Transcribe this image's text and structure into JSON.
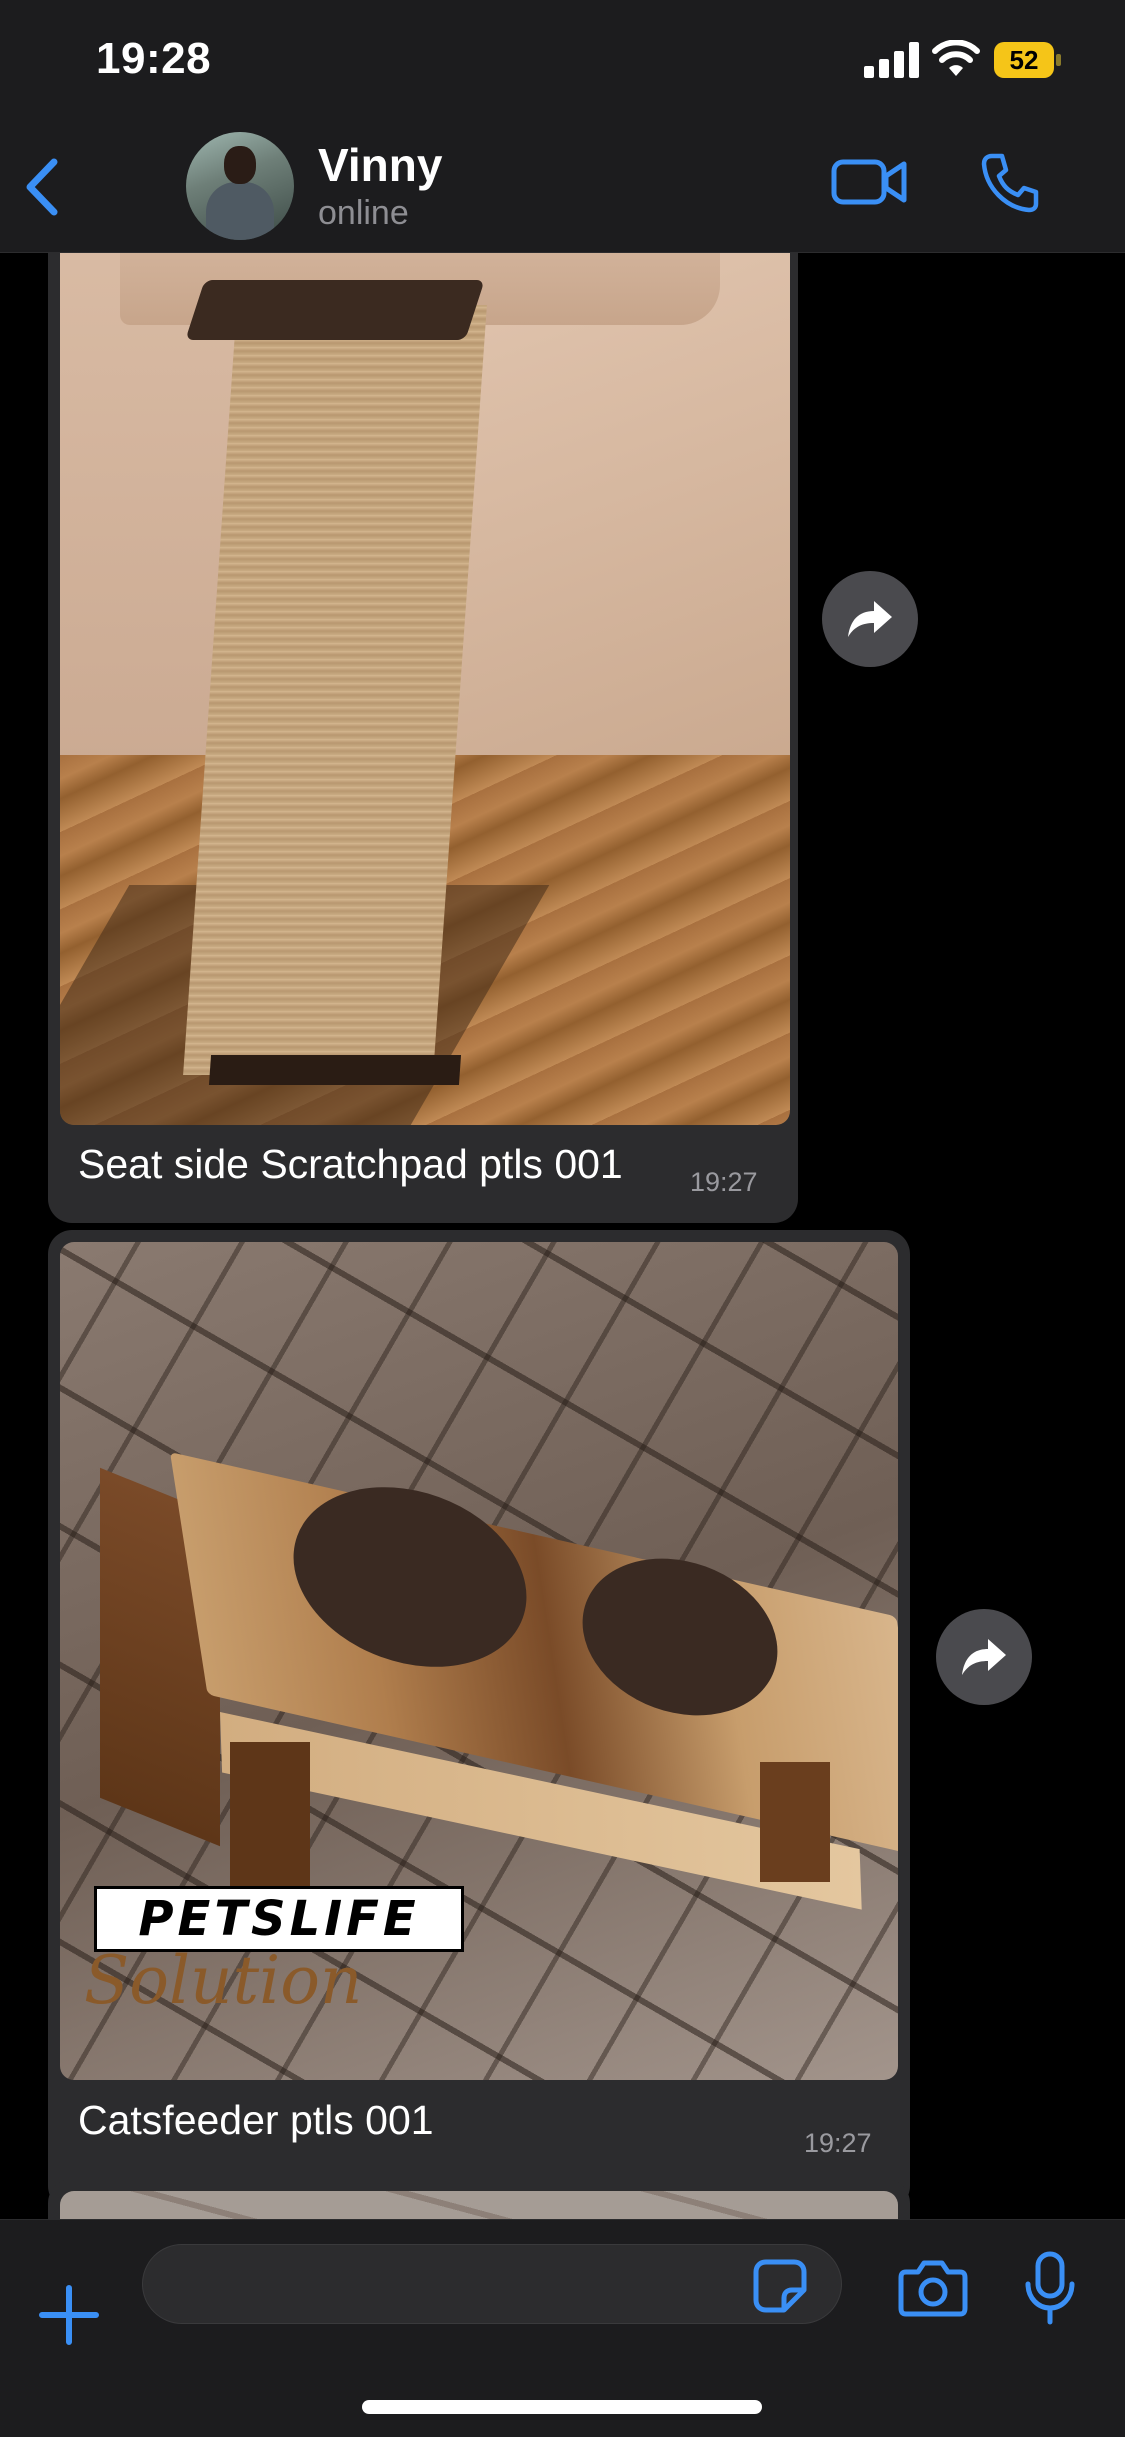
{
  "status_bar": {
    "time": "19:28",
    "battery": "52",
    "battery_color": "#f5c518"
  },
  "header": {
    "back_icon": "chevron-left-icon",
    "contact_name": "Vinny",
    "contact_status": "online",
    "video_icon": "video-camera-icon",
    "call_icon": "phone-icon",
    "accent_color": "#3a8ff5"
  },
  "messages": [
    {
      "type": "image",
      "image_description": "Sofa with jute seat side scratch pad",
      "caption": "Seat side Scratchpad ptls 001",
      "time": "19:27",
      "forward_icon": "forward-arrow-icon"
    },
    {
      "type": "image",
      "image_description": "Wooden cat feeder stand with two bowl holes",
      "caption": "Catsfeeder ptls 001",
      "time": "19:27",
      "forward_icon": "forward-arrow-icon",
      "watermark": {
        "logo_text": "PETSLIFE",
        "script_text": "Solution"
      }
    },
    {
      "type": "image",
      "partial": true
    }
  ],
  "composer": {
    "placeholder": "",
    "plus_icon": "plus-icon",
    "sticker_icon": "sticker-icon",
    "camera_icon": "camera-icon",
    "mic_icon": "microphone-icon"
  }
}
